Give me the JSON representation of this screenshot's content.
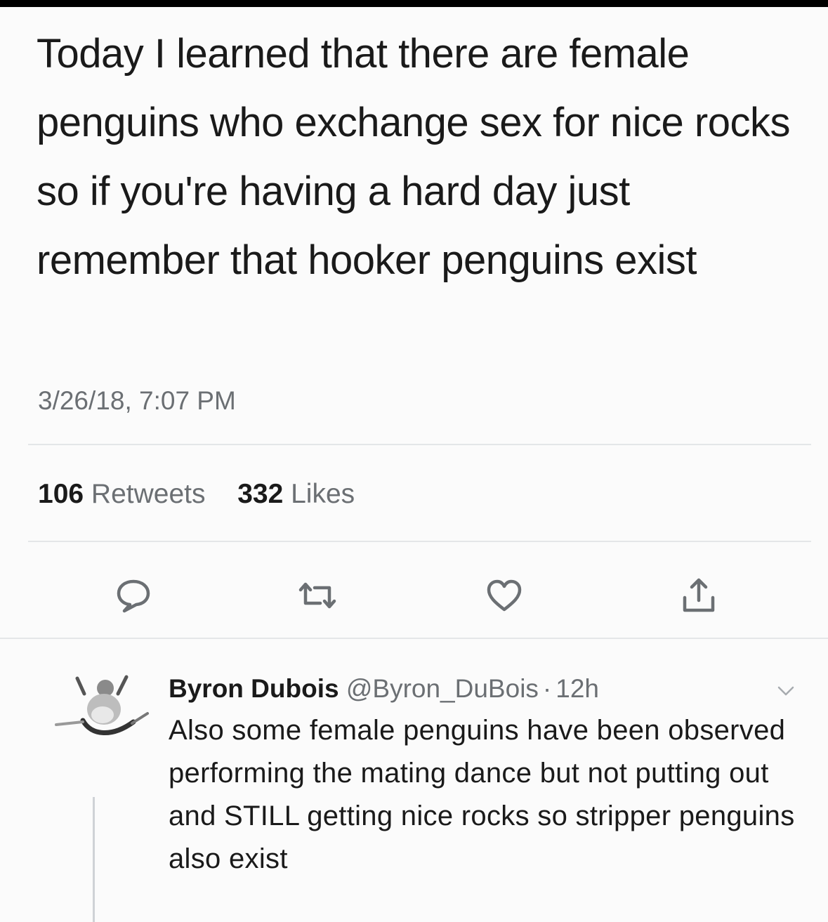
{
  "tweet": {
    "text": "Today I learned that there are female penguins who exchange sex for nice rocks so if you're having a hard day just remember that hooker penguins exist",
    "timestamp": "3/26/18, 7:07 PM",
    "retweets_count": "106",
    "retweets_label": "Retweets",
    "likes_count": "332",
    "likes_label": "Likes"
  },
  "actions": {
    "icons": [
      "speech-bubble-icon",
      "retweet-icon",
      "heart-icon",
      "share-icon"
    ]
  },
  "reply": {
    "display_name": "Byron Dubois",
    "handle": "@Byron_DuBois",
    "separator": "·",
    "time": "12h",
    "text": "Also some female penguins have been observed performing the mating dance but not putting out and STILL getting nice rocks so stripper penguins also exist"
  },
  "colors": {
    "background": "#fbfbfb",
    "text": "#1a1a1a",
    "muted": "#6b6f73",
    "divider": "#e4e6e8"
  }
}
